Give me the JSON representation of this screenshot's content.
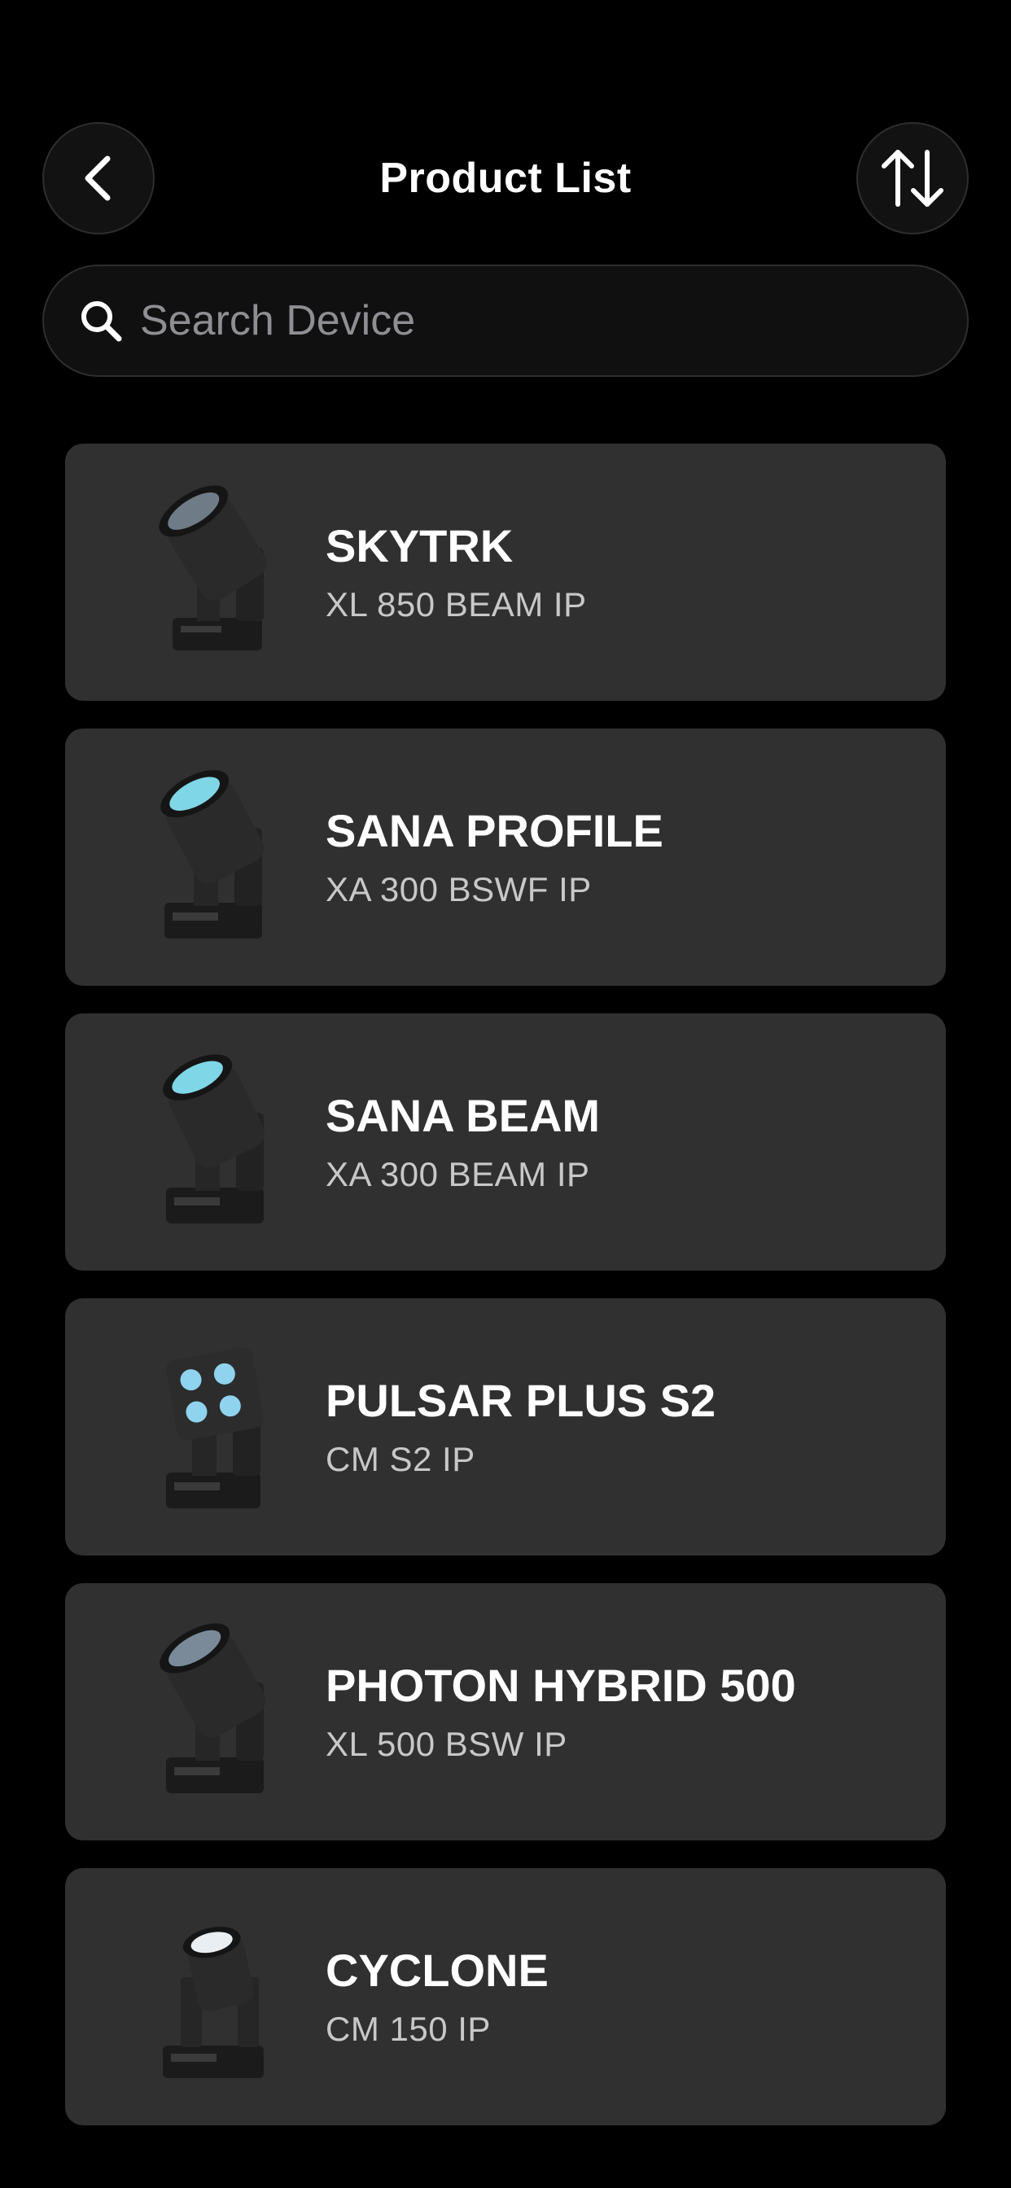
{
  "header": {
    "title": "Product List",
    "back_icon": "chevron-left-icon",
    "sort_icon": "sort-arrows-icon"
  },
  "search": {
    "placeholder": "Search Device",
    "value": "",
    "icon": "search-icon"
  },
  "products": [
    {
      "name": "SKYTRK",
      "model": "XL 850 BEAM IP",
      "image": "moving-head-beam-large",
      "lens_color": "#6f7b86"
    },
    {
      "name": "SANA PROFILE",
      "model": "XA 300 BSWF IP",
      "image": "moving-head-profile",
      "lens_color": "#7fd6e6"
    },
    {
      "name": "SANA BEAM",
      "model": "XA 300 BEAM IP",
      "image": "moving-head-beam",
      "lens_color": "#7fd6e6"
    },
    {
      "name": "PULSAR PLUS S2",
      "model": "CM S2 IP",
      "image": "moving-head-led-wash",
      "lens_color": "#8fd3ee"
    },
    {
      "name": "PHOTON HYBRID 500",
      "model": "XL 500 BSW IP",
      "image": "moving-head-hybrid",
      "lens_color": "#7a8a98"
    },
    {
      "name": "CYCLONE",
      "model": "CM 150 IP",
      "image": "moving-head-compact",
      "lens_color": "#e8eef2"
    }
  ],
  "colors": {
    "background": "#000000",
    "card": "#303030",
    "button": "#121212",
    "placeholder": "#8e8e93",
    "subtitle": "#c8c8c8"
  }
}
